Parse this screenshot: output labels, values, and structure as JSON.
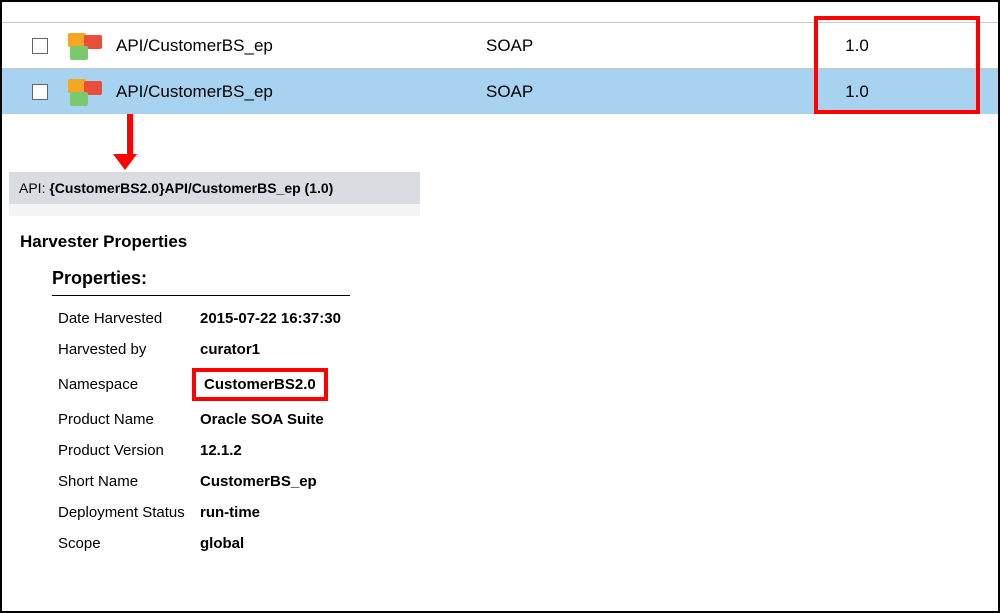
{
  "rows": [
    {
      "name": "API/CustomerBS_ep",
      "type": "SOAP",
      "version": "1.0",
      "selected": false
    },
    {
      "name": "API/CustomerBS_ep",
      "type": "SOAP",
      "version": "1.0",
      "selected": true
    }
  ],
  "apiBar": {
    "prefix": "API: ",
    "bold": "{CustomerBS2.0}API/CustomerBS_ep (1.0)"
  },
  "harvester": {
    "title": "Harvester Properties",
    "propsHeading": "Properties:",
    "properties": [
      {
        "label": "Date Harvested",
        "value": "2015-07-22 16:37:30"
      },
      {
        "label": "Harvested by",
        "value": "curator1"
      },
      {
        "label": "Namespace",
        "value": "CustomerBS2.0",
        "highlight": true
      },
      {
        "label": "Product Name",
        "value": "Oracle SOA Suite"
      },
      {
        "label": "Product Version",
        "value": "12.1.2"
      },
      {
        "label": "Short Name",
        "value": "CustomerBS_ep"
      },
      {
        "label": "Deployment Status",
        "value": "run-time"
      },
      {
        "label": "Scope",
        "value": "global"
      }
    ]
  }
}
